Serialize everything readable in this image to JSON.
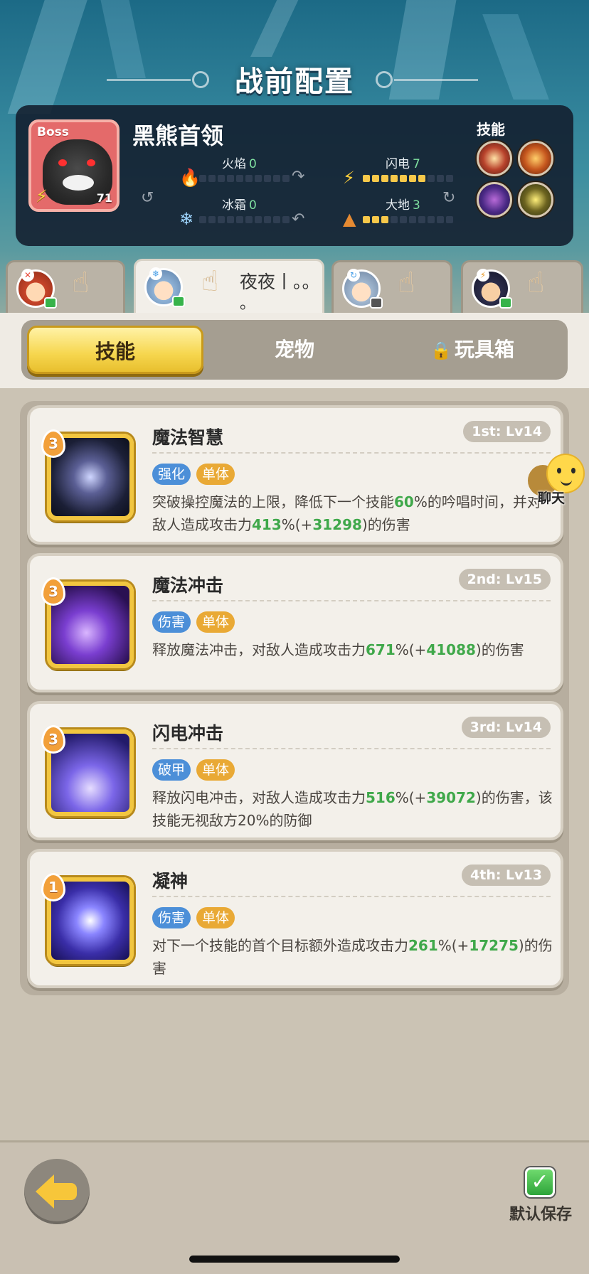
{
  "page_title": "战前配置",
  "boss": {
    "tag": "Boss",
    "name": "黑熊首领",
    "level": "71",
    "elements": {
      "fire": {
        "label": "火焰",
        "value": "0",
        "filled": 0,
        "icon": "fire-icon"
      },
      "lightning": {
        "label": "闪电",
        "value": "7",
        "filled": 7,
        "icon": "bolt-icon"
      },
      "frost": {
        "label": "冰霜",
        "value": "0",
        "filled": 0,
        "icon": "snowflake-icon"
      },
      "earth": {
        "label": "大地",
        "value": "3",
        "filled": 3,
        "icon": "mountain-icon"
      }
    },
    "skills_label": "技能",
    "skill_icons": [
      "fang-skill-icon",
      "claw-skill-icon",
      "purple-bear-skill-icon",
      "roar-skill-icon"
    ]
  },
  "heroes": [
    {
      "name": "",
      "active": false
    },
    {
      "name": "夜夜丨。。",
      "name_line2": "。",
      "active": true
    },
    {
      "name": "",
      "active": false
    },
    {
      "name": "",
      "active": false
    }
  ],
  "tabs": {
    "skills": "技能",
    "pets": "宠物",
    "toybox": "玩具箱"
  },
  "skills": [
    {
      "rank": "3",
      "title": "魔法智慧",
      "order": "1st: Lv14",
      "tags": [
        "强化",
        "单体"
      ],
      "desc": {
        "p1": "突破操控魔法的上限，降低下一个技能",
        "h1": "60",
        "p2": "%的吟唱时间，并对敌人造成攻击力",
        "h2": "413",
        "p3": "%(+",
        "h3": "31298",
        "p4": ")的伤害"
      }
    },
    {
      "rank": "3",
      "title": "魔法冲击",
      "order": "2nd: Lv15",
      "tags": [
        "伤害",
        "单体"
      ],
      "desc": {
        "p1": "释放魔法冲击，对敌人造成攻击力",
        "h1": "671",
        "p2": "%(+",
        "h2": "41088",
        "p3": ")的伤害"
      }
    },
    {
      "rank": "3",
      "title": "闪电冲击",
      "order": "3rd: Lv14",
      "tags": [
        "破甲",
        "单体"
      ],
      "desc": {
        "p1": "释放闪电冲击，对敌人造成攻击力",
        "h1": "516",
        "p2": "%(+",
        "h2": "39072",
        "p3": ")的伤害，该技能无视敌方20%的防御"
      }
    },
    {
      "rank": "1",
      "title": "凝神",
      "order": "4th: Lv13",
      "tags": [
        "伤害",
        "单体"
      ],
      "desc": {
        "p1": "对下一个技能的首个目标额外造成攻击力",
        "h1": "261",
        "p2": "%(+",
        "h2": "17275",
        "p3": ")的伤害"
      }
    }
  ],
  "chat": {
    "label": "聊天"
  },
  "bottom": {
    "save_label": "默认保存"
  },
  "colors": {
    "accent_yellow": "#f6d64e",
    "highlight_green": "#3fa84a",
    "tag_blue": "#4c8fd8",
    "tag_gold": "#e9a935"
  }
}
